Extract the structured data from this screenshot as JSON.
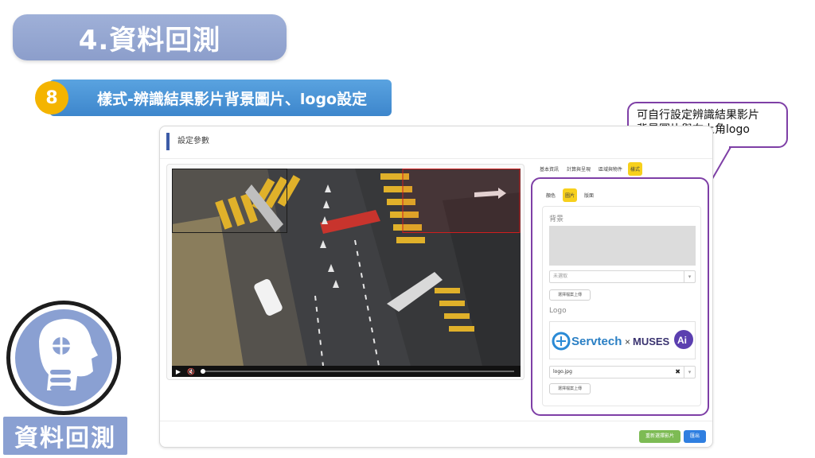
{
  "slide": {
    "title": "4.資料回測",
    "step_number": "8",
    "step_title": "樣式-辨識結果影片背景圖片、logo設定",
    "callout_line1": "可自行設定辨識結果影片",
    "callout_line2": "背景圖片與右上角logo",
    "bottom_label": "資料回測"
  },
  "panel": {
    "header": "設定參數",
    "top_tabs": [
      "基本資訊",
      "計算與呈現",
      "區域與物件",
      "樣式"
    ],
    "active_top_tab": "樣式",
    "sub_tabs": [
      "顏色",
      "圖片",
      "版面"
    ],
    "active_sub_tab": "圖片",
    "background_label": "背景",
    "background_select": "未選取",
    "upload_label_1": "選擇檔案上傳",
    "logo_label": "Logo",
    "logo_select": "logo.jpg",
    "upload_label_2": "選擇檔案上傳",
    "logo_text_left": "Servtech",
    "logo_text_times": "×",
    "logo_text_right": "MUSES",
    "logo_text_ai": "Ai",
    "btn_reselect": "重新選擇影片",
    "btn_output": "匯出"
  },
  "colors": {
    "title_pill": "#8c9ecb",
    "step_bar": "#3d86cc",
    "step_badge": "#f4b400",
    "highlight": "#7e3fa6",
    "tab_active": "#f7d01c",
    "btn_green": "#7dbb54",
    "btn_blue": "#2f7fe0"
  },
  "icons": {
    "play": "play-icon",
    "volume": "mute-icon",
    "clear": "close-icon",
    "caret": "chevron-down-icon",
    "avatar": "head-silhouette-icon"
  }
}
